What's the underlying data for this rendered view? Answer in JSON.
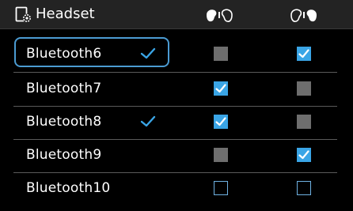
{
  "header": {
    "title": "Headset"
  },
  "colors": {
    "accent": "#3aa5e6",
    "selection_outline": "#4b9bd2",
    "disabled_box": "#6e6e6e",
    "header_bg": "#232323"
  },
  "columns": [
    {
      "icon": "headset-left-active-icon"
    },
    {
      "icon": "headset-right-active-icon"
    }
  ],
  "devices": [
    {
      "name": "Bluetooth6",
      "connected": true,
      "focused": true,
      "left": "disabled",
      "right": "checked"
    },
    {
      "name": "Bluetooth7",
      "connected": false,
      "focused": false,
      "left": "checked",
      "right": "disabled"
    },
    {
      "name": "Bluetooth8",
      "connected": true,
      "focused": false,
      "left": "checked",
      "right": "disabled"
    },
    {
      "name": "Bluetooth9",
      "connected": false,
      "focused": false,
      "left": "disabled",
      "right": "checked"
    },
    {
      "name": "Bluetooth10",
      "connected": false,
      "focused": false,
      "left": "unchecked",
      "right": "unchecked"
    }
  ]
}
